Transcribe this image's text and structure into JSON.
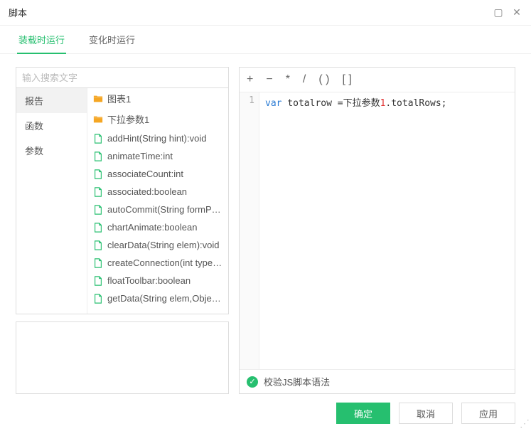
{
  "window": {
    "title": "脚本"
  },
  "tabs": [
    {
      "label": "装载时运行",
      "active": true
    },
    {
      "label": "变化时运行",
      "active": false
    }
  ],
  "search": {
    "placeholder": "输入搜索文字"
  },
  "categories": [
    {
      "label": "报告",
      "active": true
    },
    {
      "label": "函数",
      "active": false
    },
    {
      "label": "参数",
      "active": false
    }
  ],
  "tree_items": [
    {
      "type": "folder",
      "label": "图表1"
    },
    {
      "type": "folder",
      "label": "下拉参数1"
    },
    {
      "type": "file",
      "label": "addHint(String hint):void"
    },
    {
      "type": "file",
      "label": "animateTime:int"
    },
    {
      "type": "file",
      "label": "associateCount:int"
    },
    {
      "type": "file",
      "label": "associated:boolean"
    },
    {
      "type": "file",
      "label": "autoCommit(String formParm..."
    },
    {
      "type": "file",
      "label": "chartAnimate:boolean"
    },
    {
      "type": "file",
      "label": "clearData(String elem):void"
    },
    {
      "type": "file",
      "label": "createConnection(int type,Str..."
    },
    {
      "type": "file",
      "label": "floatToolbar:boolean"
    },
    {
      "type": "file",
      "label": "getData(String elem,Object o..."
    }
  ],
  "editor_toolbar": {
    "plus": "+",
    "minus": "−",
    "star": "*",
    "slash": "/",
    "parens": "( )",
    "brackets": "[ ]"
  },
  "editor": {
    "line_number": "1",
    "keyword": "var",
    "ident1": " totalrow =下拉参数",
    "number": "1",
    "rest": ".totalRows;"
  },
  "validation": {
    "label": "校验JS脚本语法"
  },
  "buttons": {
    "ok": "确定",
    "cancel": "取消",
    "apply": "应用"
  },
  "icons": {
    "folder_color": "#f5a623",
    "file_color": "#26bf6f"
  }
}
